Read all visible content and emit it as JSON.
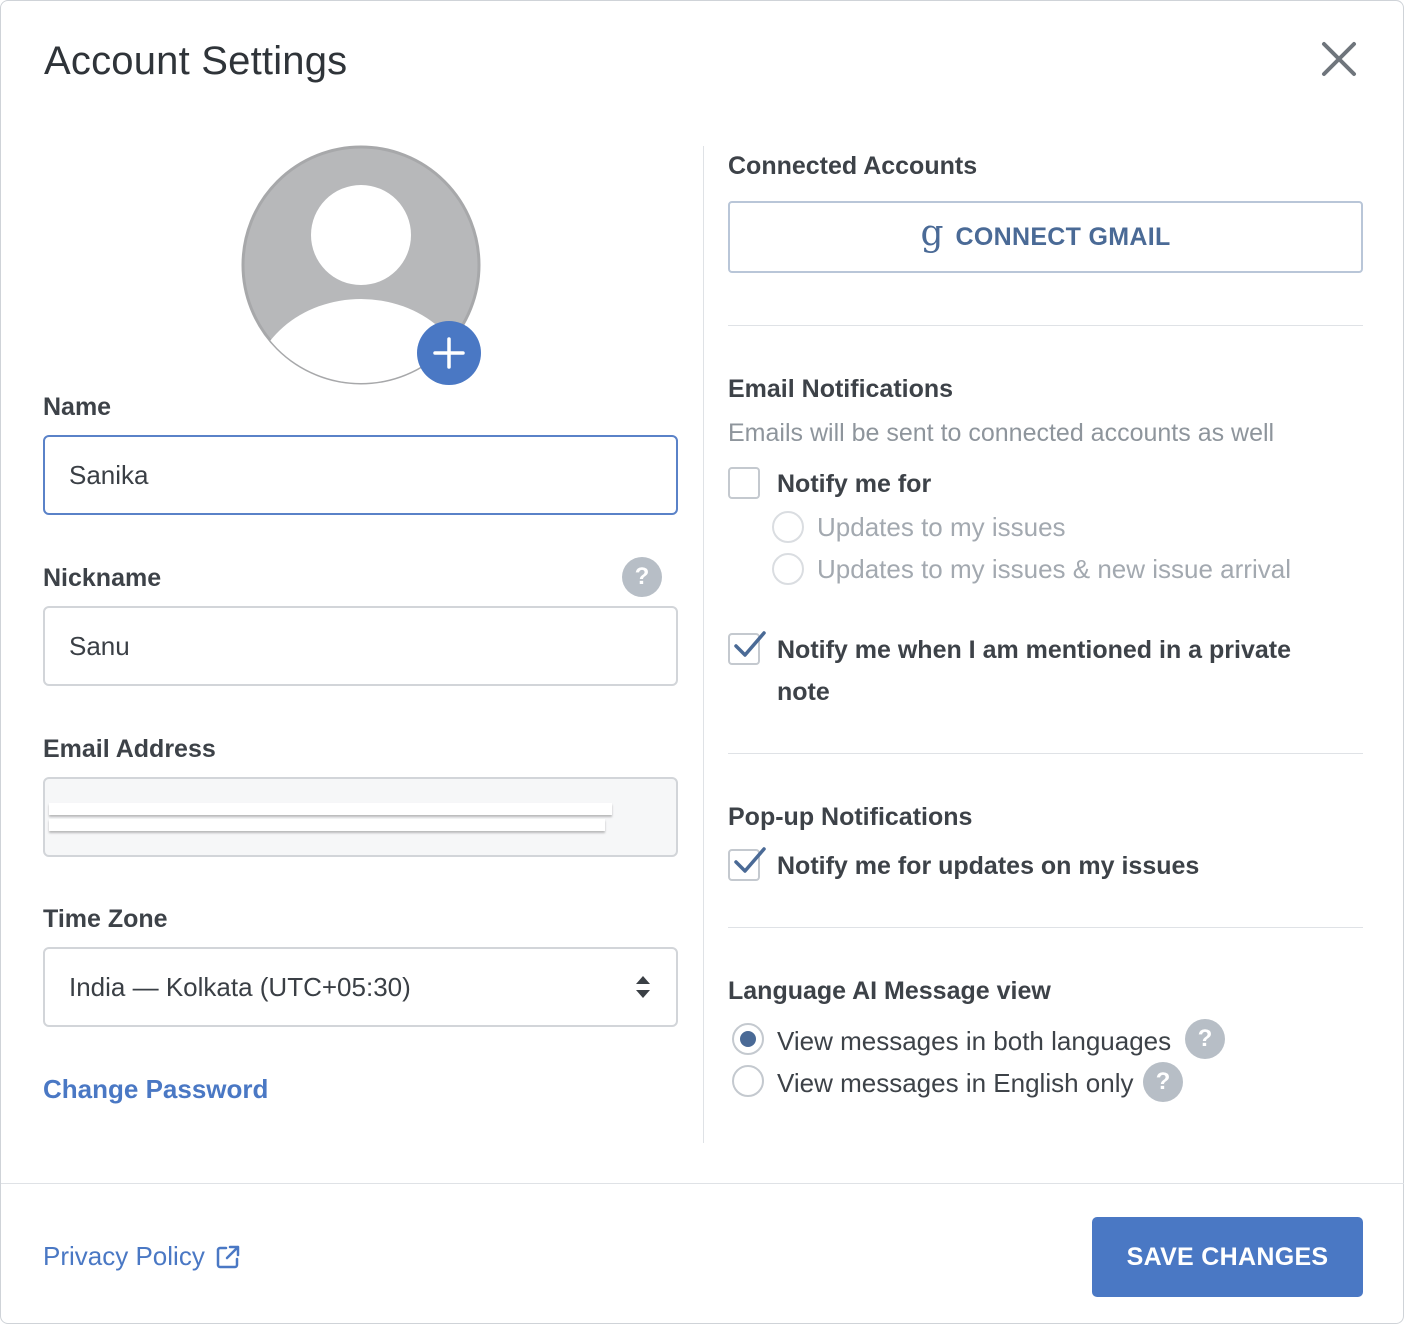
{
  "dialog": {
    "title": "Account Settings"
  },
  "profile": {
    "name_label": "Name",
    "name_value": "Sanika",
    "nickname_label": "Nickname",
    "nickname_value": "Sanu",
    "email_label": "Email Address",
    "timezone_label": "Time Zone",
    "timezone_value": "India — Kolkata (UTC+05:30)",
    "change_password": "Change Password",
    "help_glyph": "?"
  },
  "connected": {
    "title": "Connected Accounts",
    "gmail_icon": "g",
    "gmail_button": "CONNECT GMAIL"
  },
  "email_notifications": {
    "title": "Email Notifications",
    "subtitle": "Emails will be sent to connected accounts as well",
    "notify_me_for": "Notify me for",
    "notify_me_for_checked": false,
    "option_updates": "Updates to my issues",
    "option_updates_new": "Updates to my issues & new issue arrival",
    "mention_line1": "Notify me when I am mentioned in a private",
    "mention_line2": "note",
    "mention_checked": true
  },
  "popup_notifications": {
    "title": "Pop-up Notifications",
    "updates_label": "Notify me for updates on my issues",
    "updates_checked": true
  },
  "language": {
    "title": "Language AI Message view",
    "both_label": "View messages in both languages",
    "english_label": "View messages in English only",
    "selected": "both"
  },
  "footer": {
    "privacy_policy": "Privacy Policy",
    "save_button": "SAVE CHANGES"
  },
  "colors": {
    "accent": "#4a78c4",
    "muted_text": "#8e959c",
    "help_badge": "#b7bec6"
  }
}
